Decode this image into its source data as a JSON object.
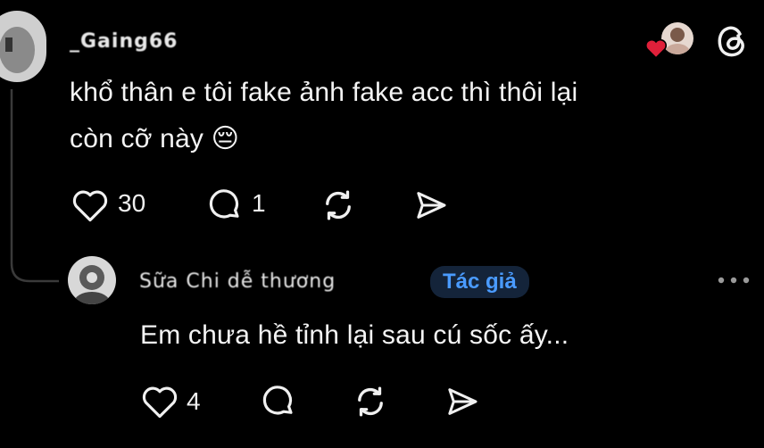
{
  "comment": {
    "username": "_Gaing66",
    "text_line1": "khổ thân e tôi fake ảnh fake acc thì thôi lại",
    "text_line2": "còn cỡ này",
    "emoji": "😔",
    "likes": "30",
    "replies": "1"
  },
  "reply": {
    "username": "Sữa Chi dễ thương",
    "author_badge": "Tác giả",
    "text": "Em chưa hề tỉnh lại sau cú sốc ấy...",
    "likes": "4"
  },
  "colors": {
    "background": "#000000",
    "text": "#f3f3f3",
    "badge_bg": "#14243a",
    "badge_text": "#4a9bff",
    "heart_red": "#e0203a"
  },
  "icons": [
    "heart-icon",
    "comment-icon",
    "repost-icon",
    "share-icon",
    "threads-logo-icon",
    "more-icon"
  ]
}
